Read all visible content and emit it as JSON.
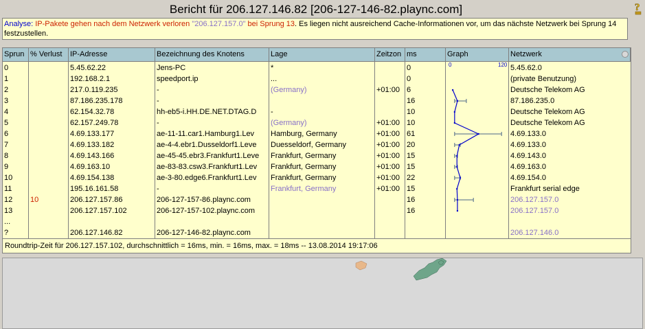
{
  "title": "Bericht für 206.127.146.82 [206-127-146-82.plaync.com]",
  "analysis": {
    "prefix": "Analyse: ",
    "red_text": "IP-Pakete gehen nach dem Netzwerk verloren ",
    "purple_text": "\"206.127.157.0\"",
    "red_text2": " bei Sprung 13",
    "rest": ". Es liegen nicht ausreichend Cache-Informationen vor, um das nächste Netzwerk bei Sprung 14 festzustellen."
  },
  "columns": [
    "Sprun",
    "% Verlust",
    "IP-Adresse",
    "Bezeichnung des Knotens",
    "Lage",
    "Zeitzon",
    "ms",
    "Graph",
    "Netzwerk"
  ],
  "graph_scale": {
    "min_label": "0",
    "max_label": "120",
    "max": 120
  },
  "rows": [
    {
      "hop": "0",
      "loss": "",
      "ip": "5.45.62.22",
      "name": "Jens-PC",
      "loc": "*",
      "tz": "",
      "ms": "0",
      "net": "5.45.62.0",
      "loc_purple": false,
      "net_purple": false
    },
    {
      "hop": "1",
      "loss": "",
      "ip": "192.168.2.1",
      "name": "speedport.ip",
      "loc": "...",
      "tz": "",
      "ms": "0",
      "net": "(private Benutzung)",
      "loc_purple": false,
      "net_purple": false
    },
    {
      "hop": "2",
      "loss": "",
      "ip": "217.0.119.235",
      "name": "-",
      "loc": "(Germany)",
      "tz": "+01:00",
      "ms": "6",
      "net": "Deutsche Telekom AG",
      "loc_purple": true,
      "net_purple": false
    },
    {
      "hop": "3",
      "loss": "",
      "ip": "87.186.235.178",
      "name": "-",
      "loc": "",
      "tz": "",
      "ms": "16",
      "net": "87.186.235.0",
      "loc_purple": false,
      "net_purple": false
    },
    {
      "hop": "4",
      "loss": "",
      "ip": "62.154.32.78",
      "name": "hh-eb5-i.HH.DE.NET.DTAG.D",
      "loc": "-",
      "tz": "",
      "ms": "10",
      "net": "Deutsche Telekom AG",
      "loc_purple": false,
      "net_purple": false
    },
    {
      "hop": "5",
      "loss": "",
      "ip": "62.157.249.78",
      "name": "-",
      "loc": "(Germany)",
      "tz": "+01:00",
      "ms": "10",
      "net": "Deutsche Telekom AG",
      "loc_purple": true,
      "net_purple": false
    },
    {
      "hop": "6",
      "loss": "",
      "ip": "4.69.133.177",
      "name": "ae-11-11.car1.Hamburg1.Lev",
      "loc": "Hamburg, Germany",
      "tz": "+01:00",
      "ms": "61",
      "net": "4.69.133.0",
      "loc_purple": false,
      "net_purple": false
    },
    {
      "hop": "7",
      "loss": "",
      "ip": "4.69.133.182",
      "name": "ae-4-4.ebr1.Dusseldorf1.Leve",
      "loc": "Duesseldorf, Germany",
      "tz": "+01:00",
      "ms": "20",
      "net": "4.69.133.0",
      "loc_purple": false,
      "net_purple": false
    },
    {
      "hop": "8",
      "loss": "",
      "ip": "4.69.143.166",
      "name": "ae-45-45.ebr3.Frankfurt1.Leve",
      "loc": "Frankfurt, Germany",
      "tz": "+01:00",
      "ms": "15",
      "net": "4.69.143.0",
      "loc_purple": false,
      "net_purple": false
    },
    {
      "hop": "9",
      "loss": "",
      "ip": "4.69.163.10",
      "name": "ae-83-83.csw3.Frankfurt1.Lev",
      "loc": "Frankfurt, Germany",
      "tz": "+01:00",
      "ms": "15",
      "net": "4.69.163.0",
      "loc_purple": false,
      "net_purple": false
    },
    {
      "hop": "10",
      "loss": "",
      "ip": "4.69.154.138",
      "name": "ae-3-80.edge6.Frankfurt1.Lev",
      "loc": "Frankfurt, Germany",
      "tz": "+01:00",
      "ms": "22",
      "net": "4.69.154.0",
      "loc_purple": false,
      "net_purple": false
    },
    {
      "hop": "11",
      "loss": "",
      "ip": "195.16.161.58",
      "name": "-",
      "loc": "Frankfurt, Germany",
      "tz": "+01:00",
      "ms": "15",
      "net": "Frankfurt serial edge",
      "loc_purple": true,
      "net_purple": false
    },
    {
      "hop": "12",
      "loss": "10",
      "ip": "206.127.157.86",
      "name": "206-127-157-86.plaync.com",
      "loc": "",
      "tz": "",
      "ms": "16",
      "net": "206.127.157.0",
      "loc_purple": false,
      "net_purple": true
    },
    {
      "hop": "13",
      "loss": "",
      "ip": "206.127.157.102",
      "name": "206-127-157-102.plaync.com",
      "loc": "",
      "tz": "",
      "ms": "16",
      "net": "206.127.157.0",
      "loc_purple": false,
      "net_purple": true
    },
    {
      "hop": "...",
      "loss": "",
      "ip": "",
      "name": "",
      "loc": "",
      "tz": "",
      "ms": "",
      "net": "",
      "loc_purple": false,
      "net_purple": false
    },
    {
      "hop": "?",
      "loss": "",
      "ip": "206.127.146.82",
      "name": "206-127-146-82.plaync.com",
      "loc": "",
      "tz": "",
      "ms": "",
      "net": "206.127.146.0",
      "loc_purple": false,
      "net_purple": true
    }
  ],
  "graph_points": [
    {
      "hop": "2",
      "ms": 6,
      "err_lo": 6,
      "err_hi": 6
    },
    {
      "hop": "3",
      "ms": 16,
      "err_lo": 10,
      "err_hi": 35
    },
    {
      "hop": "4",
      "ms": 10,
      "err_lo": 10,
      "err_hi": 10
    },
    {
      "hop": "5",
      "ms": 10,
      "err_lo": 10,
      "err_hi": 10
    },
    {
      "hop": "6",
      "ms": 61,
      "err_lo": 10,
      "err_hi": 110
    },
    {
      "hop": "7",
      "ms": 20,
      "err_lo": 10,
      "err_hi": 22
    },
    {
      "hop": "8",
      "ms": 15,
      "err_lo": 10,
      "err_hi": 16
    },
    {
      "hop": "9",
      "ms": 15,
      "err_lo": 10,
      "err_hi": 16
    },
    {
      "hop": "10",
      "ms": 22,
      "err_lo": 10,
      "err_hi": 22
    },
    {
      "hop": "11",
      "ms": 15,
      "err_lo": 15,
      "err_hi": 15
    },
    {
      "hop": "12",
      "ms": 16,
      "err_lo": 10,
      "err_hi": 50
    },
    {
      "hop": "13",
      "ms": 16,
      "err_lo": 16,
      "err_hi": 16
    }
  ],
  "footer": "Roundtrip-Zeit für 206.127.157.102, durchschnittlich = 16ms, min. = 16ms, max. = 18ms -- 13.08.2014 19:17:06",
  "colors": {
    "header_bg": "#a8c8d0",
    "table_bg": "#ffffcc",
    "graph_line": "#0000cc",
    "error_bar": "#4a6688",
    "map_land": "#6fa58a",
    "map_land2": "#e8b88a"
  },
  "icons": {
    "help": "question-mark-icon",
    "column_toggle": "radio-circle-icon"
  }
}
